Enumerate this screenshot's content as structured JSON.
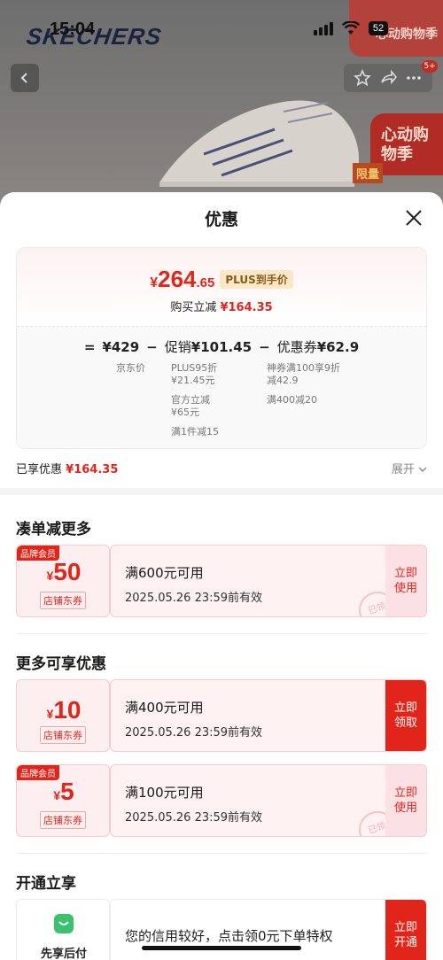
{
  "background": {
    "status_time": "15:04",
    "battery": "52",
    "brand_logo": "SKECHERS",
    "corner_promo": "心动购物季",
    "heart_promo": "心动购物季",
    "limit_tag": "限量",
    "msg_badge": "5+"
  },
  "sheet": {
    "title": "优惠",
    "summary": {
      "price_currency": "¥",
      "price_int": "264",
      "price_dec": ".65",
      "plus_tag": "PLUS到手价",
      "reduce_label": "购买立减",
      "reduce_amount": "¥164.35",
      "equals": "=",
      "jd_price": "¥429",
      "jd_price_label": "京东价",
      "minus": "−",
      "promo_label": "促销",
      "promo_amount": "¥101.45",
      "coupon_label": "优惠券",
      "coupon_amount": "¥62.9",
      "promo_details": [
        "PLUS95折",
        "¥21.45元",
        "官方立减",
        "¥65元",
        "满1件减15"
      ],
      "coupon_details": [
        "神券满100享9折",
        "减42.9",
        "满400减20"
      ]
    },
    "enjoyed_label": "已享优惠",
    "enjoyed_amount": "¥164.35",
    "expand_label": "展开"
  },
  "sections": {
    "combine_title": "凑单减更多",
    "more_title": "更多可享优惠",
    "open_title": "开通立享"
  },
  "coupons": [
    {
      "member": "品牌会员",
      "currency": "¥",
      "amount": "50",
      "shop_tag": "店铺东券",
      "condition": "满600元可用",
      "date": "2025.05.26 23:59前有效",
      "action": "立即使用",
      "stamp": "已领"
    },
    {
      "member": "",
      "currency": "¥",
      "amount": "10",
      "shop_tag": "店铺东券",
      "condition": "满400元可用",
      "date": "2025.05.26 23:59前有效",
      "action": "立即领取",
      "stamp": ""
    },
    {
      "member": "品牌会员",
      "currency": "¥",
      "amount": "5",
      "shop_tag": "店铺东券",
      "condition": "满100元可用",
      "date": "2025.05.26 23:59前有效",
      "action": "立即使用",
      "stamp": "已领"
    }
  ],
  "bnpl": {
    "label": "先享后付",
    "text": "您的信用较好，点击领0元下单特权",
    "action": "立即开通"
  },
  "colors": {
    "accent": "#e1251b",
    "plus_tag_bg": "#fbe8c8"
  }
}
